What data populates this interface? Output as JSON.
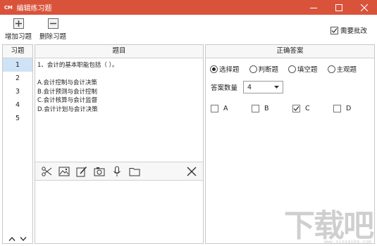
{
  "window": {
    "logo": "CM",
    "title": "编辑练习题",
    "controls": [
      "minimize-icon",
      "maximize-icon",
      "close-icon"
    ]
  },
  "toolbar": {
    "add_label": "增加习题",
    "delete_label": "删除习题",
    "need_review_label": "需要批改",
    "need_review_checked": true
  },
  "exercise_list": {
    "header": "习题",
    "items": [
      "1",
      "2",
      "3",
      "4",
      "5"
    ],
    "selected": "1",
    "selected_color": "#cfe3f7"
  },
  "question": {
    "header": "题目",
    "lines": [
      "1、会计的基本职能包括（  ）。",
      "",
      "A.会计控制与会计决策",
      "B.会计预测与会计控制",
      "C.会计核算与会计监督",
      "D.会计计划与会计决策"
    ],
    "tools": [
      "scissors-icon",
      "image-icon",
      "edit-icon",
      "camera-icon",
      "microphone-icon",
      "folder-icon",
      "close-x-icon"
    ]
  },
  "answer": {
    "header": "正确答案",
    "types": [
      {
        "label": "选择题",
        "selected": true
      },
      {
        "label": "判断题",
        "selected": false
      },
      {
        "label": "填空题",
        "selected": false
      },
      {
        "label": "主观题",
        "selected": false
      }
    ],
    "count_label": "答案数量",
    "count_value": "4",
    "options": [
      {
        "label": "A",
        "checked": false
      },
      {
        "label": "B",
        "checked": false
      },
      {
        "label": "C",
        "checked": true
      },
      {
        "label": "D",
        "checked": false
      }
    ]
  },
  "watermark": {
    "text": "下载吧",
    "sub": "www.xiazaiba.com"
  },
  "colors": {
    "titlebar": "#d9533b",
    "panel_border": "#c8c8c8"
  }
}
